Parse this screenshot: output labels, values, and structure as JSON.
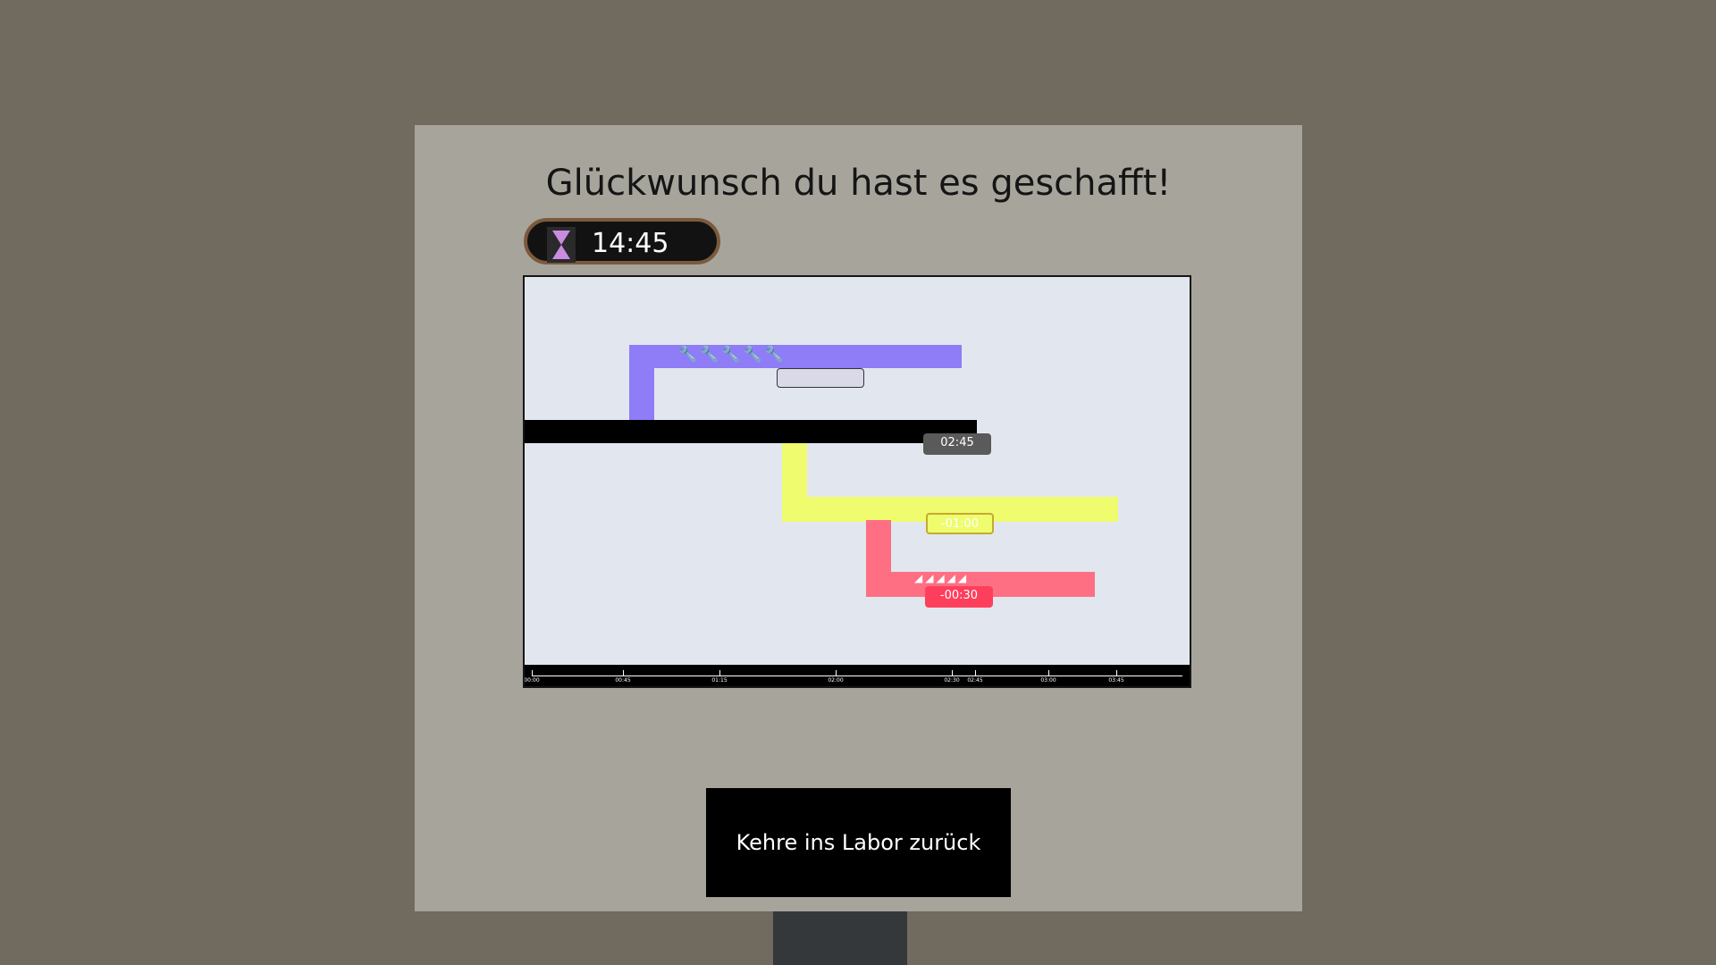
{
  "title": "Glückwunsch du hast es geschafft!",
  "timer": {
    "icon": "hourglass-icon",
    "value": "14:45"
  },
  "timeline": {
    "tracks": [
      {
        "name": "purple-track",
        "color": "#8f7cf7",
        "icons": "🔧🔧🔧🔧🔧",
        "icon_name": "wrench-icon",
        "tag": ""
      },
      {
        "name": "black-track",
        "color": "#000000",
        "tag": "02:45"
      },
      {
        "name": "yellow-track",
        "color": "#eefc6e",
        "tag": "-01:00"
      },
      {
        "name": "red-track",
        "color": "#fe6f84",
        "icons": "◢◢◢◢◢",
        "icon_name": "hammer-icon",
        "tag": "-00:30"
      }
    ],
    "axis_ticks": [
      "00:00",
      "00:45",
      "01:15",
      "02:00",
      "02:30",
      "02:45",
      "03:00",
      "03:45"
    ]
  },
  "button": {
    "label": "Kehre ins Labor zurück"
  }
}
